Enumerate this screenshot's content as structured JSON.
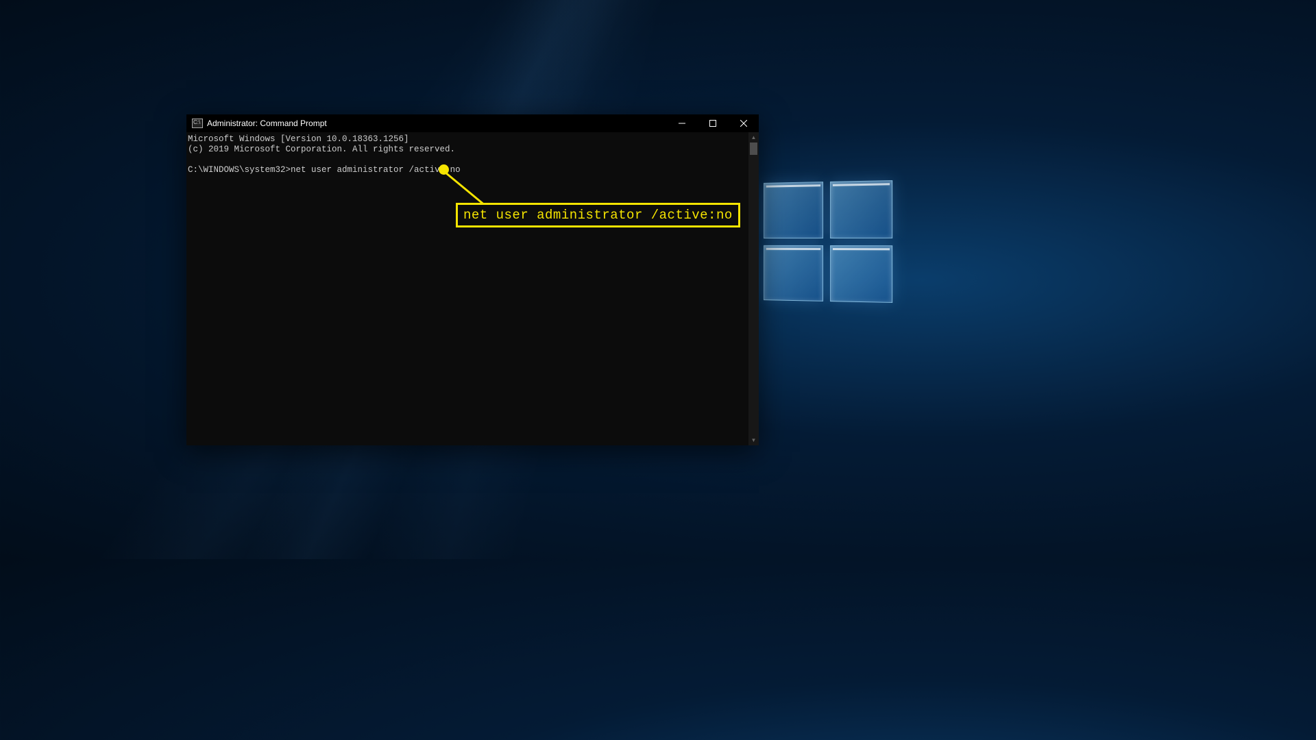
{
  "desktop": {
    "os": "Windows 10"
  },
  "window": {
    "title": "Administrator: Command Prompt"
  },
  "terminal": {
    "line1": "Microsoft Windows [Version 10.0.18363.1256]",
    "line2": "(c) 2019 Microsoft Corporation. All rights reserved.",
    "prompt": "C:\\WINDOWS\\system32>",
    "command": "net user administrator /active:no"
  },
  "callout": {
    "text": "net user administrator /active:no"
  }
}
